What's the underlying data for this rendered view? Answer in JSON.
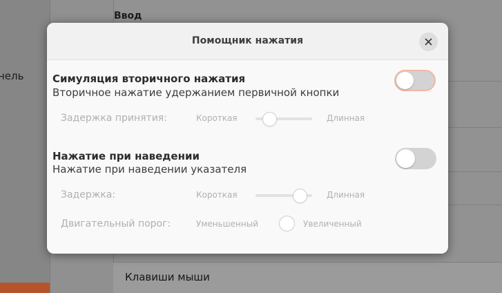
{
  "background": {
    "sidebar_item_label": "нель",
    "section_title": "Ввод",
    "bottom_row_label": "Клавиши мыши",
    "accent_color": "#b5542b"
  },
  "dialog": {
    "title": "Помощник нажатия",
    "close_icon": "close-icon",
    "secondary_click": {
      "heading": "Симуляция вторичного нажатия",
      "description": "Вторичное нажатие удержанием первичной кнопки",
      "enabled": false,
      "delay": {
        "label": "Задержка принятия:",
        "min_label": "Короткая",
        "max_label": "Длинная",
        "value_fraction": 0.25
      }
    },
    "hover_click": {
      "heading": "Нажатие при наведении",
      "description": "Нажатие при наведении указателя",
      "enabled": false,
      "delay": {
        "label": "Задержка:",
        "min_label": "Короткая",
        "max_label": "Длинная",
        "value_fraction": 0.8
      },
      "motion_threshold": {
        "label": "Двигательный порог:",
        "min_label": "Уменьшенный",
        "max_label": "Увеличенный"
      }
    }
  }
}
